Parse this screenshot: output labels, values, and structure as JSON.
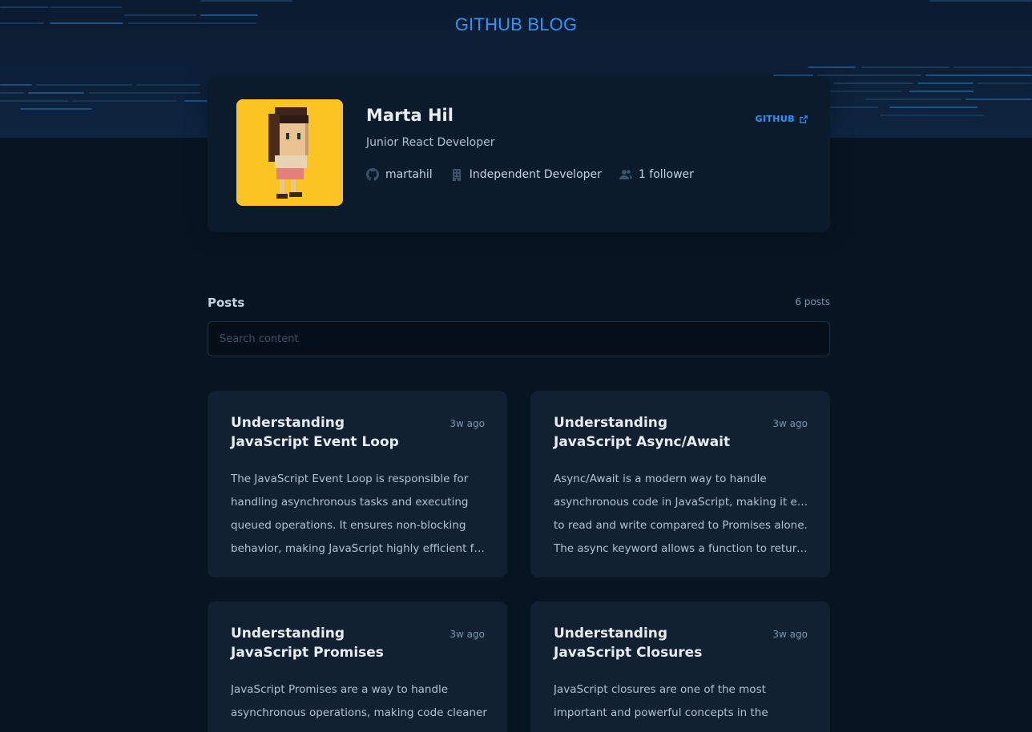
{
  "header": {
    "brand": "GITHUB BLOG"
  },
  "profile": {
    "name": "Marta Hil",
    "title": "Junior React Developer",
    "github_label": "GITHUB",
    "username": "martahil",
    "company": "Independent Developer",
    "followers": "1 follower",
    "avatar_background": "#fcc423"
  },
  "posts": {
    "heading": "Posts",
    "count": "6 posts",
    "search_placeholder": "Search content",
    "items": [
      {
        "title": "Understanding JavaScript Event Loop",
        "date": "3w ago",
        "lines": [
          "The JavaScript Event Loop is responsible for",
          "handling asynchronous tasks and executing",
          "queued operations. It ensures non-blocking",
          "behavior, making JavaScript highly efficient for..."
        ]
      },
      {
        "title": "Understanding JavaScript Async/Await",
        "date": "3w ago",
        "lines": [
          "Async/Await is a modern way to handle",
          "asynchronous code in JavaScript, making it easier",
          "to read and write compared to Promises alone.",
          "The async keyword allows a function to return ..."
        ]
      },
      {
        "title": "Understanding JavaScript Promises",
        "date": "3w ago",
        "lines": [
          "JavaScript Promises are a way to handle",
          "asynchronous operations, making code cleaner"
        ]
      },
      {
        "title": "Understanding JavaScript Closures",
        "date": "3w ago",
        "lines": [
          "JavaScript closures are one of the most",
          "important and powerful concepts in the"
        ]
      }
    ]
  },
  "colors": {
    "accent": "#3294f8",
    "background": "#071422",
    "profile": "#0b1b2b",
    "card": "#112131"
  }
}
